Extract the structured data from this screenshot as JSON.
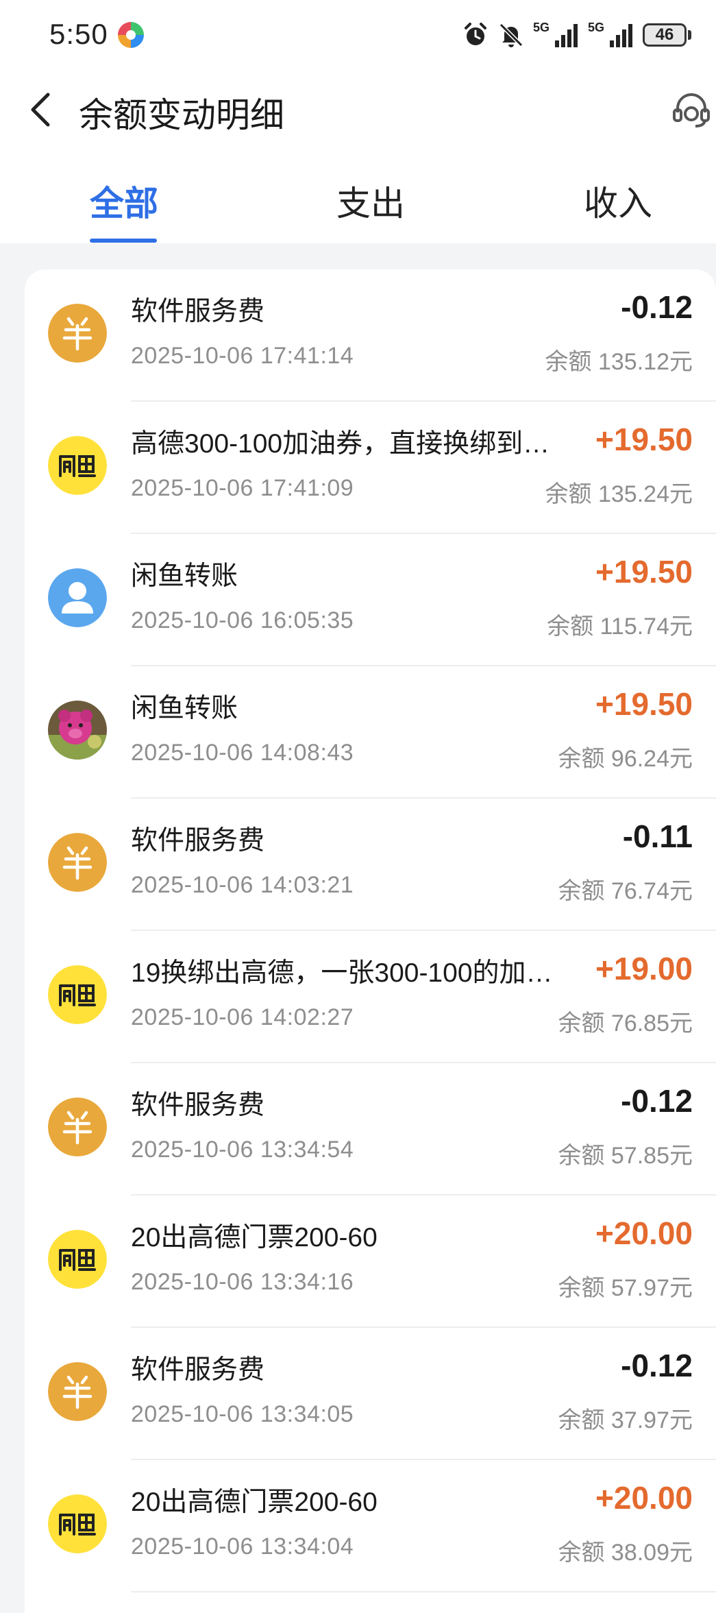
{
  "status_bar": {
    "time": "5:50",
    "net1": "5G",
    "net2": "5G",
    "battery": "46"
  },
  "header": {
    "title": "余额变动明细"
  },
  "tabs": [
    {
      "label": "全部",
      "active": true
    },
    {
      "label": "支出",
      "active": false
    },
    {
      "label": "收入",
      "active": false
    }
  ],
  "colors": {
    "accent_blue": "#2f6fe6",
    "income_orange": "#e46a2e",
    "fee_icon_bg": "#e9a83b",
    "xianyu_icon_bg": "#ffe13a",
    "user_icon_bg": "#5aa7ee"
  },
  "transactions": [
    {
      "title": "软件服务费",
      "time": "2025-10-06 17:41:14",
      "amount": "-0.12",
      "balance": "余额 135.12元",
      "icon": "fee-yuan-icon"
    },
    {
      "title": "高德300-100加油券，直接换绑到…",
      "time": "2025-10-06 17:41:09",
      "amount": "+19.50",
      "balance": "余额 135.24元",
      "icon": "xianyu-logo-icon"
    },
    {
      "title": "闲鱼转账",
      "time": "2025-10-06 16:05:35",
      "amount": "+19.50",
      "balance": "余额 115.74元",
      "icon": "user-avatar-icon"
    },
    {
      "title": "闲鱼转账",
      "time": "2025-10-06 14:08:43",
      "amount": "+19.50",
      "balance": "余额 96.24元",
      "icon": "photo-avatar"
    },
    {
      "title": "软件服务费",
      "time": "2025-10-06 14:03:21",
      "amount": "-0.11",
      "balance": "余额 76.74元",
      "icon": "fee-yuan-icon"
    },
    {
      "title": "19换绑出高德，一张300-100的加…",
      "time": "2025-10-06 14:02:27",
      "amount": "+19.00",
      "balance": "余额 76.85元",
      "icon": "xianyu-logo-icon"
    },
    {
      "title": "软件服务费",
      "time": "2025-10-06 13:34:54",
      "amount": "-0.12",
      "balance": "余额 57.85元",
      "icon": "fee-yuan-icon"
    },
    {
      "title": "20出高德门票200-60",
      "time": "2025-10-06 13:34:16",
      "amount": "+20.00",
      "balance": "余额 57.97元",
      "icon": "xianyu-logo-icon"
    },
    {
      "title": "软件服务费",
      "time": "2025-10-06 13:34:05",
      "amount": "-0.12",
      "balance": "余额 37.97元",
      "icon": "fee-yuan-icon"
    },
    {
      "title": "20出高德门票200-60",
      "time": "2025-10-06 13:34:04",
      "amount": "+20.00",
      "balance": "余额 38.09元",
      "icon": "xianyu-logo-icon"
    }
  ]
}
